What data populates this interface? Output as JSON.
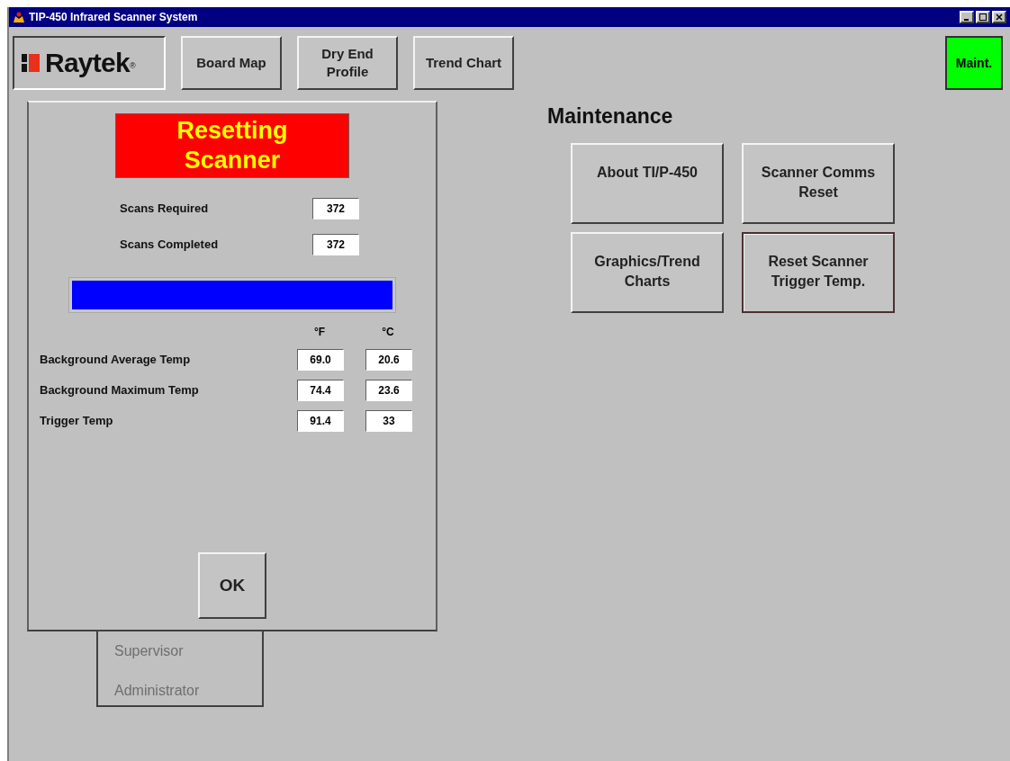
{
  "window": {
    "title": "TIP-450 Infrared Scanner System"
  },
  "logo": {
    "text": "Raytek",
    "mark": "®"
  },
  "nav_buttons": [
    {
      "label": "Board Map",
      "active": false
    },
    {
      "label": "Dry End Profile",
      "active": false
    },
    {
      "label": "Trend Chart",
      "active": false
    }
  ],
  "maint_button": {
    "label": "Maint.",
    "active": true
  },
  "dialog": {
    "status": "Resetting Scanner",
    "counts": [
      {
        "label": "Scans Required",
        "value": "372"
      },
      {
        "label": "Scans Completed",
        "value": "372"
      }
    ],
    "progress": {
      "level": 1
    },
    "temp_headers": [
      "°F",
      "°C"
    ],
    "temps": [
      {
        "label": "Background Average Temp",
        "f": "69.0",
        "c": "20.6"
      },
      {
        "label": "Background Maximum Temp",
        "f": "74.4",
        "c": "23.6"
      },
      {
        "label": "Trigger Temp",
        "f": "91.4",
        "c": "33"
      }
    ],
    "ok": "OK"
  },
  "maintenance": {
    "title": "Maintenance",
    "buttons": [
      {
        "label": "About TI/P-450",
        "focused": false
      },
      {
        "label": "Scanner Comms Reset",
        "focused": false
      },
      {
        "label": "Graphics/Trend Charts",
        "focused": false
      },
      {
        "label": "Reset Scanner Trigger Temp.",
        "focused": true
      }
    ]
  },
  "user_menu": [
    {
      "label": "Supervisor",
      "disabled": true
    },
    {
      "label": "Administrator",
      "disabled": true
    }
  ]
}
